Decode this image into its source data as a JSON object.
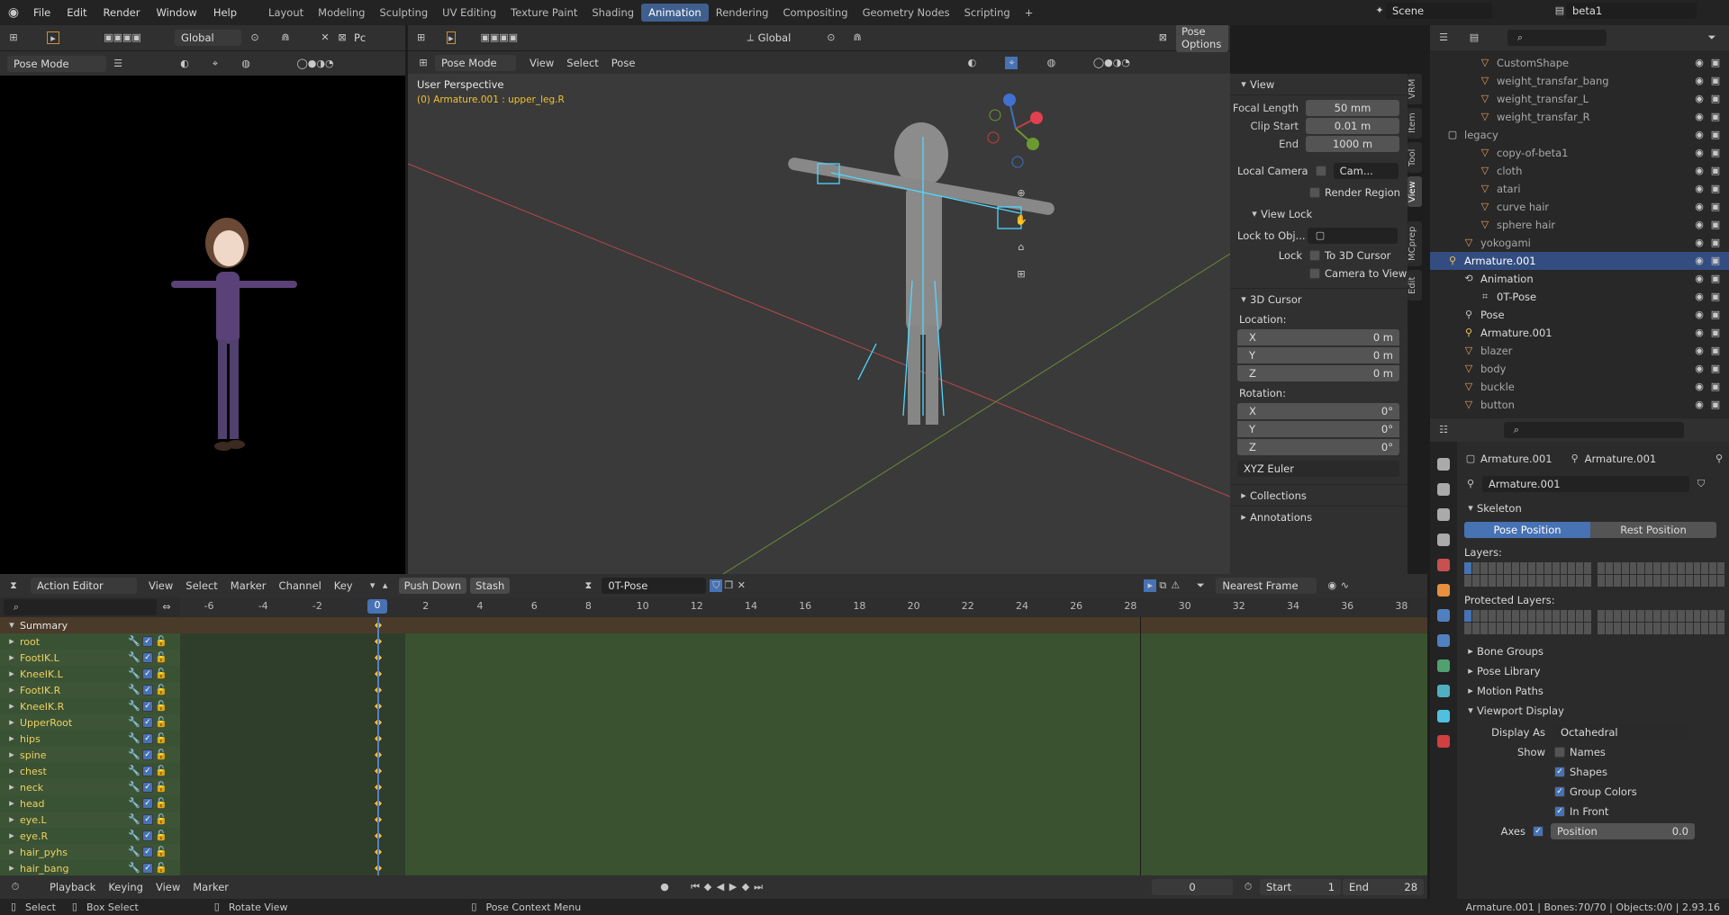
{
  "topbar": {
    "menus": [
      "File",
      "Edit",
      "Render",
      "Window",
      "Help"
    ],
    "workspaces": [
      "Layout",
      "Modeling",
      "Sculpting",
      "UV Editing",
      "Texture Paint",
      "Shading",
      "Animation",
      "Rendering",
      "Compositing",
      "Geometry Nodes",
      "Scripting"
    ],
    "active_workspace": "Animation",
    "add": "+",
    "scene": "Scene",
    "view_layer": "beta1"
  },
  "camview": {
    "mode": "Pose Mode",
    "orient": "Global",
    "cut": "Pc"
  },
  "viewport": {
    "mode": "Pose Mode",
    "menus": [
      "View",
      "Select",
      "Pose"
    ],
    "orient": "Global",
    "pose_options": "Pose Options",
    "perspective": "User Perspective",
    "object_info": "(0) Armature.001 : upper_leg.R"
  },
  "npanel": {
    "view_title": "View",
    "focal_length_label": "Focal Length",
    "focal_length": "50 mm",
    "clip_start_label": "Clip Start",
    "clip_start": "0.01 m",
    "end_label": "End",
    "end": "1000 m",
    "local_camera": "Local Camera",
    "cam_field": "Cam...",
    "render_region": "Render Region",
    "view_lock": "View Lock",
    "lock_to_obj": "Lock to Obj...",
    "lock": "Lock",
    "to_3d_cursor": "To 3D Cursor",
    "camera_to_view": "Camera to View",
    "cursor_title": "3D Cursor",
    "location": "Location:",
    "rotation": "Rotation:",
    "x": "X",
    "y": "Y",
    "z": "Z",
    "zero_m": "0 m",
    "zero_deg": "0°",
    "euler": "XYZ Euler",
    "collections": "Collections",
    "annotations": "Annotations",
    "tabs": [
      "VRM",
      "Item",
      "Tool",
      "View",
      "MCprep",
      "Edit"
    ]
  },
  "outliner": {
    "items": [
      {
        "label": "CustomShape",
        "indent": 3,
        "color": "#a8a8a8",
        "icon": "mesh"
      },
      {
        "label": "weight_transfar_bang",
        "indent": 3,
        "color": "#a8a8a8",
        "icon": "mesh"
      },
      {
        "label": "weight_transfar_L",
        "indent": 3,
        "color": "#a8a8a8",
        "icon": "mesh"
      },
      {
        "label": "weight_transfar_R",
        "indent": 3,
        "color": "#a8a8a8",
        "icon": "mesh"
      },
      {
        "label": "legacy",
        "indent": 1,
        "color": "#a8a8a8",
        "icon": "collection"
      },
      {
        "label": "copy-of-beta1",
        "indent": 3,
        "color": "#a8a8a8",
        "icon": "mesh"
      },
      {
        "label": "cloth",
        "indent": 3,
        "color": "#a8a8a8",
        "icon": "mesh"
      },
      {
        "label": "atari",
        "indent": 3,
        "color": "#a8a8a8",
        "icon": "mesh"
      },
      {
        "label": "curve hair",
        "indent": 3,
        "color": "#a8a8a8",
        "icon": "mesh"
      },
      {
        "label": "sphere hair",
        "indent": 3,
        "color": "#a8a8a8",
        "icon": "mesh"
      },
      {
        "label": "yokogami",
        "indent": 2,
        "color": "#a8a8a8",
        "icon": "mesh"
      },
      {
        "label": "Armature.001",
        "indent": 1,
        "color": "#ffffff",
        "icon": "armature",
        "selected": true
      },
      {
        "label": "Animation",
        "indent": 2,
        "color": "#dcdcdc",
        "icon": "anim"
      },
      {
        "label": "0T-Pose",
        "indent": 3,
        "color": "#dcdcdc",
        "icon": "action"
      },
      {
        "label": "Pose",
        "indent": 2,
        "color": "#dcdcdc",
        "icon": "pose"
      },
      {
        "label": "Armature.001",
        "indent": 2,
        "color": "#dcdcdc",
        "icon": "armature"
      },
      {
        "label": "blazer",
        "indent": 2,
        "color": "#a8a8a8",
        "icon": "mesh"
      },
      {
        "label": "body",
        "indent": 2,
        "color": "#a8a8a8",
        "icon": "mesh"
      },
      {
        "label": "buckle",
        "indent": 2,
        "color": "#a8a8a8",
        "icon": "mesh"
      },
      {
        "label": "button",
        "indent": 2,
        "color": "#a8a8a8",
        "icon": "mesh"
      }
    ]
  },
  "properties": {
    "obj1": "Armature.001",
    "obj2": "Armature.001",
    "data_name": "Armature.001",
    "skeleton": "Skeleton",
    "pose_position": "Pose Position",
    "rest_position": "Rest Position",
    "layers": "Layers:",
    "protected_layers": "Protected Layers:",
    "bone_groups": "Bone Groups",
    "pose_library": "Pose Library",
    "motion_paths": "Motion Paths",
    "viewport_display": "Viewport Display",
    "display_as_label": "Display As",
    "display_as": "Octahedral",
    "show": "Show",
    "names": "Names",
    "shapes": "Shapes",
    "group_colors": "Group Colors",
    "in_front": "In Front",
    "axes": "Axes",
    "position_label": "Position",
    "position_value": "0.0"
  },
  "action": {
    "editor": "Action Editor",
    "menus": [
      "View",
      "Select",
      "Marker",
      "Channel",
      "Key"
    ],
    "push_down": "Push Down",
    "stash": "Stash",
    "action_name": "0T-Pose",
    "snap": "Nearest Frame",
    "ticks": [
      "-6",
      "-4",
      "-2",
      "0",
      "2",
      "4",
      "6",
      "8",
      "10",
      "12",
      "14",
      "16",
      "18",
      "20",
      "22",
      "24",
      "26",
      "28",
      "30",
      "32",
      "34",
      "36",
      "38"
    ],
    "current_frame": "0",
    "summary": "Summary",
    "channels": [
      "root",
      "FootIK.L",
      "KneeIK.L",
      "FootIK.R",
      "KneeIK.R",
      "UpperRoot",
      "hips",
      "spine",
      "chest",
      "neck",
      "head",
      "eye.L",
      "eye.R",
      "hair_pyhs",
      "hair_bang"
    ]
  },
  "timeline": {
    "menus": [
      "Playback",
      "Keying",
      "View",
      "Marker"
    ],
    "frame": "0",
    "start_label": "Start",
    "start": "1",
    "end_label": "End",
    "end": "28"
  },
  "status": {
    "select": "Select",
    "box_select": "Box Select",
    "rotate_view": "Rotate View",
    "pose_menu": "Pose Context Menu",
    "info": "Armature.001 | Bones:70/70 | Objects:0/0 | 2.93.16"
  }
}
